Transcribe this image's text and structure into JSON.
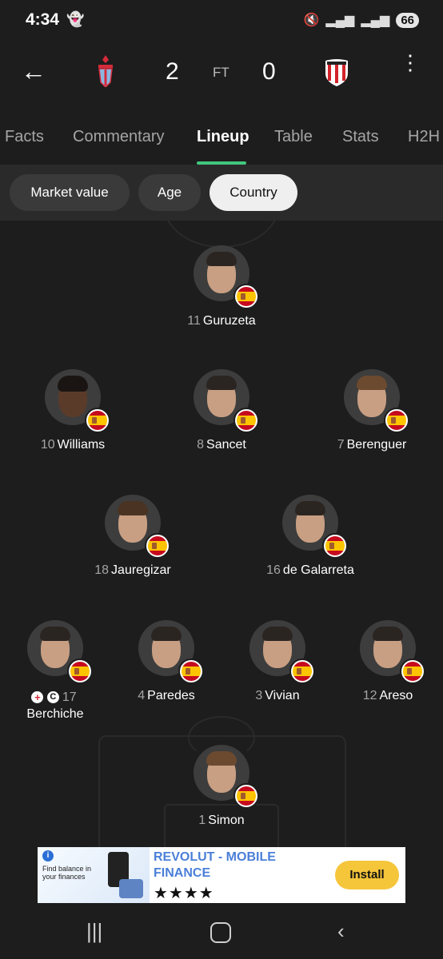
{
  "status_bar": {
    "time": "4:34",
    "battery": "66"
  },
  "match": {
    "home_score": "2",
    "away_score": "0",
    "status": "FT"
  },
  "tabs": [
    {
      "label": "Facts"
    },
    {
      "label": "Commentary"
    },
    {
      "label": "Lineup"
    },
    {
      "label": "Table"
    },
    {
      "label": "Stats"
    },
    {
      "label": "H2H"
    }
  ],
  "filters": [
    {
      "label": "Market value"
    },
    {
      "label": "Age"
    },
    {
      "label": "Country"
    }
  ],
  "players": [
    {
      "number": "11",
      "name": "Guruzeta"
    },
    {
      "number": "10",
      "name": "Williams"
    },
    {
      "number": "8",
      "name": "Sancet"
    },
    {
      "number": "7",
      "name": "Berenguer"
    },
    {
      "number": "18",
      "name": "Jauregizar"
    },
    {
      "number": "16",
      "name": "de Galarreta"
    },
    {
      "number": "17",
      "name": "Berchiche",
      "captain_mark": "C"
    },
    {
      "number": "4",
      "name": "Paredes"
    },
    {
      "number": "3",
      "name": "Vivian"
    },
    {
      "number": "12",
      "name": "Areso"
    },
    {
      "number": "1",
      "name": "Simon"
    }
  ],
  "ad": {
    "title": "REVOLUT - MOBILE FINANCE",
    "rating": "★★★★",
    "cta": "Install",
    "image_text": "Find balance in your finances"
  },
  "colors": {
    "accent": "#41c77e",
    "background": "#1d1d1d",
    "install_button": "#f5c53a"
  }
}
